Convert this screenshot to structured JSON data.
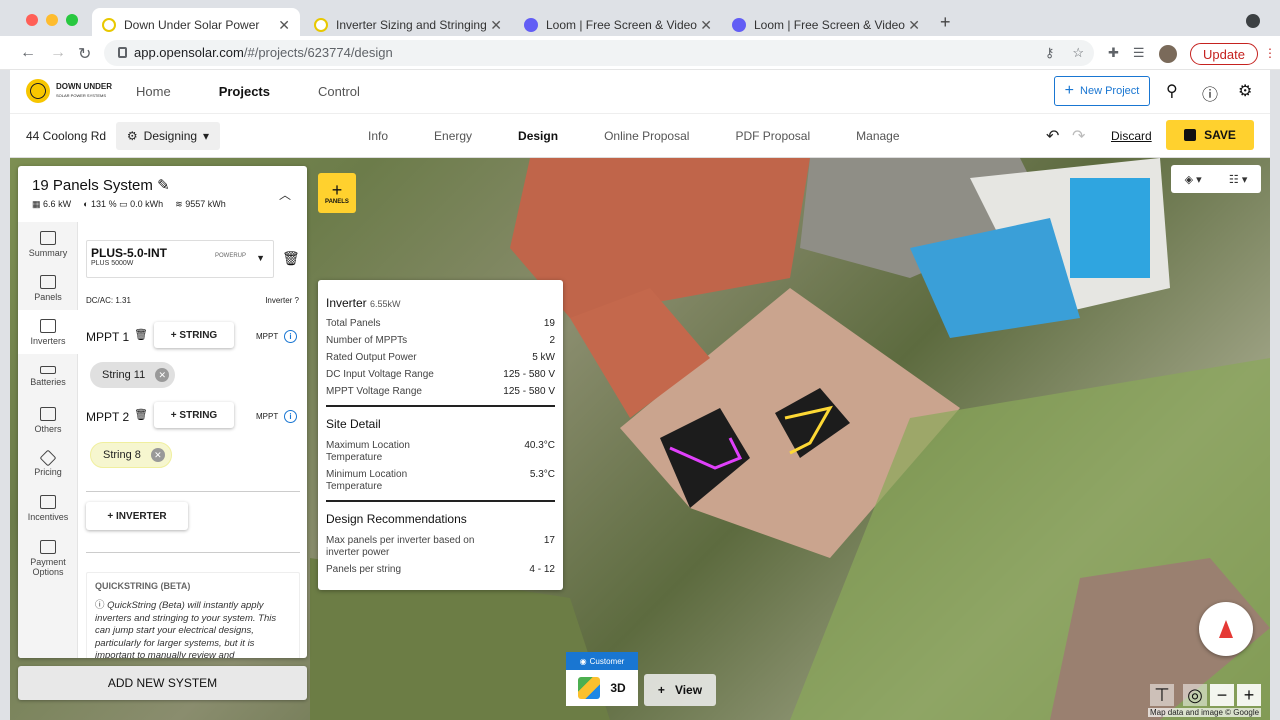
{
  "browser": {
    "tabs": [
      {
        "title": "Down Under Solar Power",
        "active": true,
        "favicon_color": "#ffd12e"
      },
      {
        "title": "Inverter Sizing and Stringing re",
        "active": false,
        "favicon_color": "#ffd12e"
      },
      {
        "title": "Loom | Free Screen & Video Re",
        "active": false,
        "favicon_color": "#625df5"
      },
      {
        "title": "Loom | Free Screen & Video Re",
        "active": false,
        "favicon_color": "#625df5"
      }
    ],
    "url_host": "app.opensolar.com",
    "url_path": "/#/projects/623774/design",
    "update_label": "Update"
  },
  "app": {
    "logo_line1": "DOWN UNDER",
    "logo_line2": "SOLAR POWER SYSTEMS",
    "nav": [
      "Home",
      "Projects",
      "Control"
    ],
    "active_nav": "Projects",
    "new_project_label": "New Project",
    "icons": [
      "search-icon",
      "help-icon",
      "gear-icon"
    ]
  },
  "project": {
    "address": "44 Coolong Rd",
    "status": "Designing",
    "tabs": [
      "Info",
      "Energy",
      "Design",
      "Online Proposal",
      "PDF Proposal",
      "Manage"
    ],
    "active_tab": "Design",
    "discard_label": "Discard",
    "save_label": "SAVE"
  },
  "system": {
    "title": "19 Panels System",
    "kw": "6.6",
    "kw_unit": "kW",
    "offset": "131",
    "offset_unit": "%",
    "battery": "0.0",
    "battery_unit": "kWh",
    "output": "9557",
    "output_unit": "kWh"
  },
  "sidenav": [
    {
      "label": "Summary",
      "icon": "summary-icon"
    },
    {
      "label": "Panels",
      "icon": "panels-icon"
    },
    {
      "label": "Inverters",
      "icon": "inverters-icon",
      "active": true
    },
    {
      "label": "Batteries",
      "icon": "battery-icon"
    },
    {
      "label": "Others",
      "icon": "others-icon"
    },
    {
      "label": "Pricing",
      "icon": "pricing-icon"
    },
    {
      "label": "Incentives",
      "icon": "incentives-icon"
    },
    {
      "label": "Payment Options",
      "icon": "payment-icon"
    }
  ],
  "inverter": {
    "model": "PLUS-5.0-INT",
    "sub": "PLUS 5000W",
    "brand": "POWERUP",
    "dcac_label": "DC/AC: 1.31",
    "help_label": "Inverter",
    "mppts": [
      {
        "label": "MPPT 1",
        "add_string": "+ STRING",
        "mppt_label": "MPPT",
        "strings": [
          {
            "label": "String 11",
            "highlight": false
          }
        ]
      },
      {
        "label": "MPPT 2",
        "add_string": "+ STRING",
        "mppt_label": "MPPT",
        "strings": [
          {
            "label": "String 8",
            "highlight": true
          }
        ]
      }
    ],
    "add_inverter_label": "+ INVERTER"
  },
  "quickstring": {
    "title": "QUICKSTRING (BETA)",
    "text": "QuickString (Beta) will instantly apply inverters and stringing to your system. This can jump start your electrical designs, particularly for larger systems, but it is important to manually review and"
  },
  "add_system_label": "ADD NEW SYSTEM",
  "panels_button_label": "PANELS",
  "tooltip": {
    "title": "Inverter",
    "title_sub": "6.55kW",
    "specs": [
      {
        "label": "Total Panels",
        "value": "19"
      },
      {
        "label": "Number of MPPTs",
        "value": "2"
      },
      {
        "label": "Rated Output Power",
        "value": "5 kW"
      },
      {
        "label": "DC Input Voltage Range",
        "value": "125 - 580 V"
      },
      {
        "label": "MPPT Voltage Range",
        "value": "125 - 580 V"
      }
    ],
    "site_title": "Site Detail",
    "site": [
      {
        "label": "Maximum Location Temperature",
        "value": "40.3°C"
      },
      {
        "label": "Minimum Location Temperature",
        "value": "5.3°C"
      }
    ],
    "rec_title": "Design Recommendations",
    "recs": [
      {
        "label": "Max panels per inverter based on inverter power",
        "value": "17"
      },
      {
        "label": "Panels per string",
        "value": "4 - 12"
      }
    ]
  },
  "map": {
    "customer_label": "Customer",
    "btn3d_label": "3D",
    "view_label": "View",
    "attribution": "Map data and image © Google",
    "string_colors": [
      "#e040fb",
      "#fdd835"
    ]
  }
}
